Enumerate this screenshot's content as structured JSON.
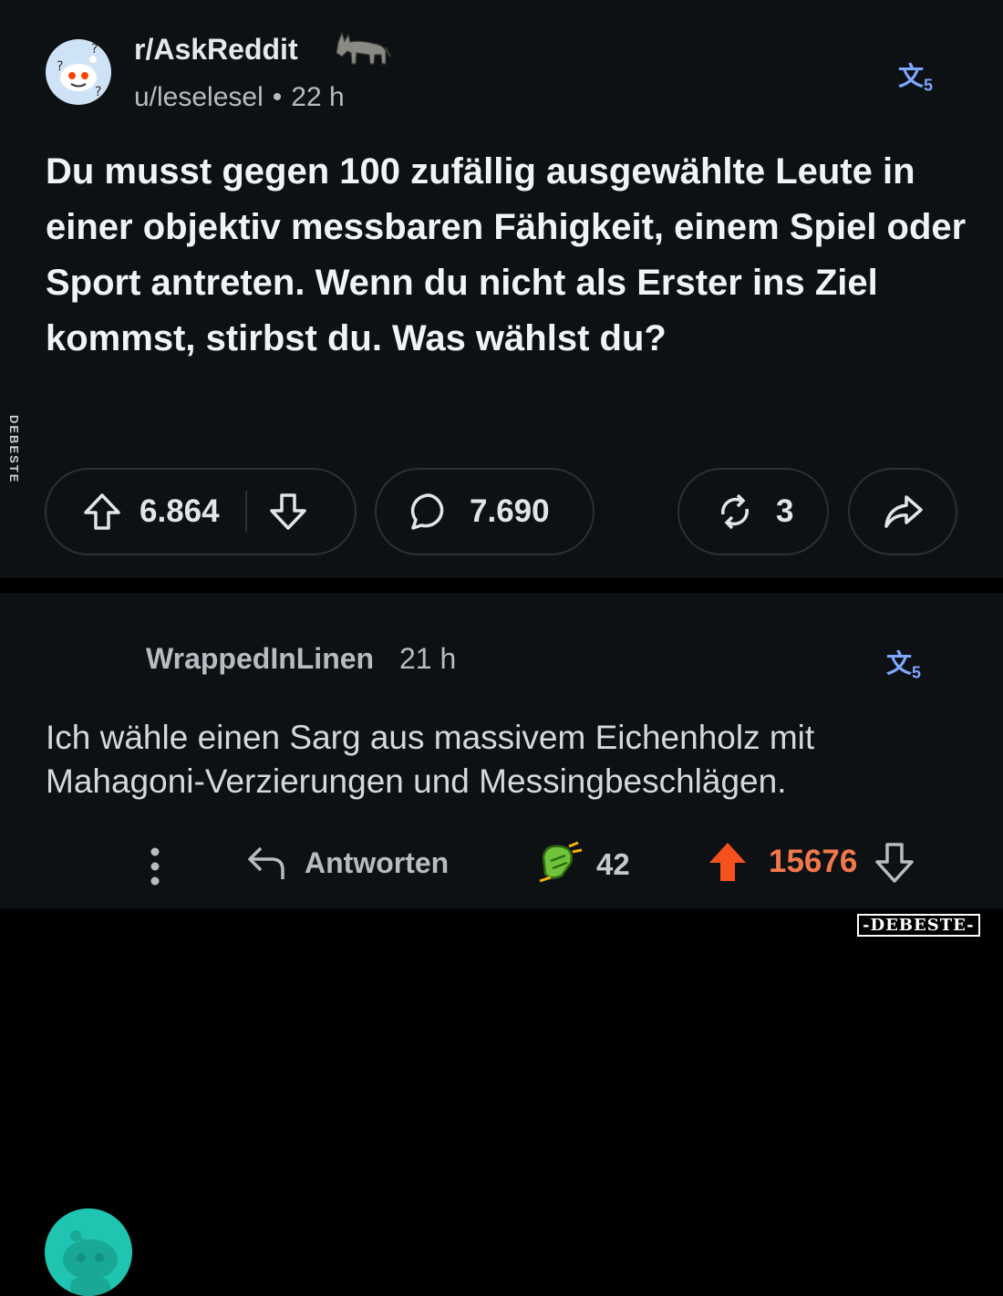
{
  "post": {
    "subreddit": "r/AskReddit",
    "author": "u/leselesel",
    "separator": "•",
    "age": "22 h",
    "title": "Du musst gegen 100 zufällig ausgewählte Leute in einer objektiv messbaren Fähigkeit, einem Spiel oder Sport antreten. Wenn du nicht als Erster ins Ziel kommst, stirbst du. Was wählst du?",
    "upvotes": "6.864",
    "comments": "7.690",
    "crossposts": "3"
  },
  "comment": {
    "author": "WrappedInLinen",
    "age": "21 h",
    "body": "Ich wähle einen Sarg aus massivem Eichenholz mit Mahagoni-Verzierungen und Messingbeschlägen.",
    "reply_label": "Antworten",
    "award_count": "42",
    "score": "15676"
  },
  "watermarks": {
    "side": "DEBESTE",
    "corner": "-DEBESTE-"
  },
  "colors": {
    "background": "#0e1114",
    "accent_upvote": "#f2784b",
    "translate_icon": "#7ea7ff"
  },
  "icons": [
    "subreddit-avatar",
    "donkey-image",
    "translate-icon",
    "upvote-arrow-icon",
    "downvote-arrow-icon",
    "comment-bubble-icon",
    "crosspost-icon",
    "share-icon",
    "more-options-icon",
    "reply-icon",
    "award-icon"
  ]
}
